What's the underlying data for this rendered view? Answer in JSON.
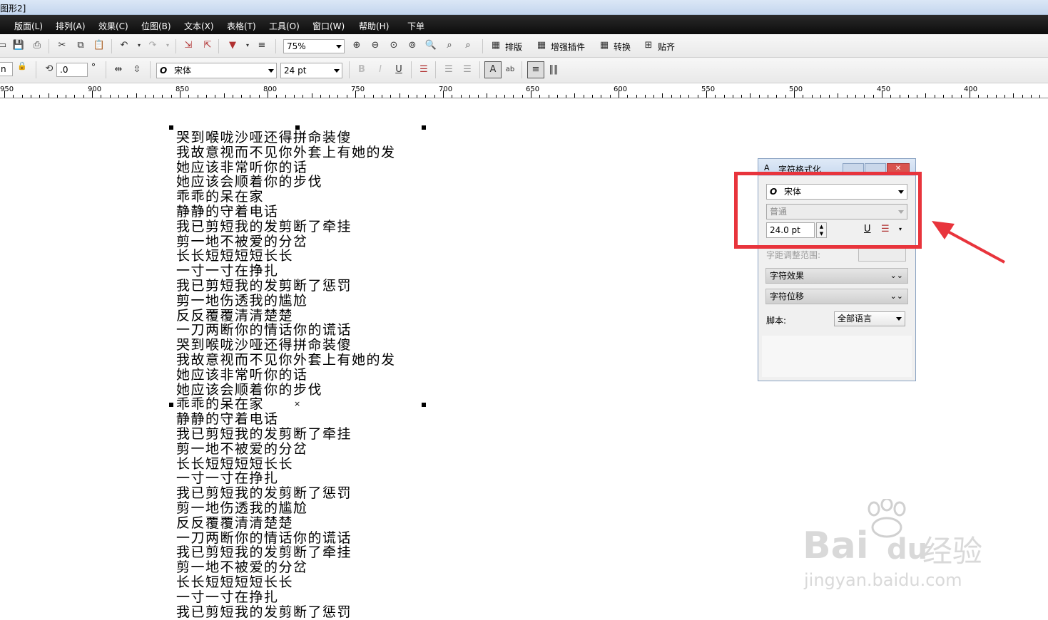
{
  "window": {
    "title": "图形2]"
  },
  "menu": [
    "版面(L)",
    "排列(A)",
    "效果(C)",
    "位图(B)",
    "文本(X)",
    "表格(T)",
    "工具(O)",
    "窗口(W)",
    "帮助(H)",
    "下单"
  ],
  "toolbar": {
    "zoom": "75%",
    "buttons": {
      "layout": "排版",
      "plugins": "增强插件",
      "convert": "转换",
      "snap": "贴齐"
    }
  },
  "propbar": {
    "unit_partial": "n",
    "rotation": ".0",
    "degree": "°",
    "font": "宋体",
    "size": "24 pt",
    "font_glyph": "O"
  },
  "ruler": {
    "labels": [
      "950",
      "900",
      "850",
      "800",
      "750",
      "700",
      "650",
      "600",
      "550",
      "500",
      "450",
      "400"
    ]
  },
  "canvas": {
    "lines": [
      "哭到喉咙沙哑还得拼命装傻",
      "我故意视而不见你外套上有她的发",
      "她应该非常听你的话",
      "她应该会顺着你的步伐",
      "乖乖的呆在家",
      "静静的守着电话",
      "我已剪短我的发剪断了牵挂",
      "剪一地不被爱的分岔",
      "长长短短短短长长",
      "一寸一寸在挣扎",
      "我已剪短我的发剪断了惩罚",
      "剪一地伤透我的尴尬",
      "反反覆覆清清楚楚",
      "一刀两断你的情话你的谎话",
      "哭到喉咙沙哑还得拼命装傻",
      "我故意视而不见你外套上有她的发",
      "她应该非常听你的话",
      "她应该会顺着你的步伐",
      "乖乖的呆在家",
      "静静的守着电话",
      "我已剪短我的发剪断了牵挂",
      "剪一地不被爱的分岔",
      "长长短短短短长长",
      "一寸一寸在挣扎",
      "我已剪短我的发剪断了惩罚",
      "剪一地伤透我的尴尬",
      "反反覆覆清清楚楚",
      "一刀两断你的情话你的谎话",
      "我已剪短我的发剪断了牵挂",
      "剪一地不被爱的分岔",
      "长长短短短短长长",
      "一寸一寸在挣扎",
      "我已剪短我的发剪断了惩罚"
    ]
  },
  "panel": {
    "title": "字符格式化",
    "font": "宋体",
    "font_glyph": "O",
    "style": "普通",
    "size": "24.0 pt",
    "kerning_label": "字距调整范围:",
    "sections": [
      "字符效果",
      "字符位移"
    ],
    "script_label": "脚本:",
    "script_value": "全部语言"
  },
  "watermark": {
    "brand": "Bai",
    "brand2": "du",
    "brand_cn": "经验",
    "url": "jingyan.baidu.com"
  },
  "colors": {
    "highlight": "#e8343c",
    "menubar": "#111111"
  }
}
